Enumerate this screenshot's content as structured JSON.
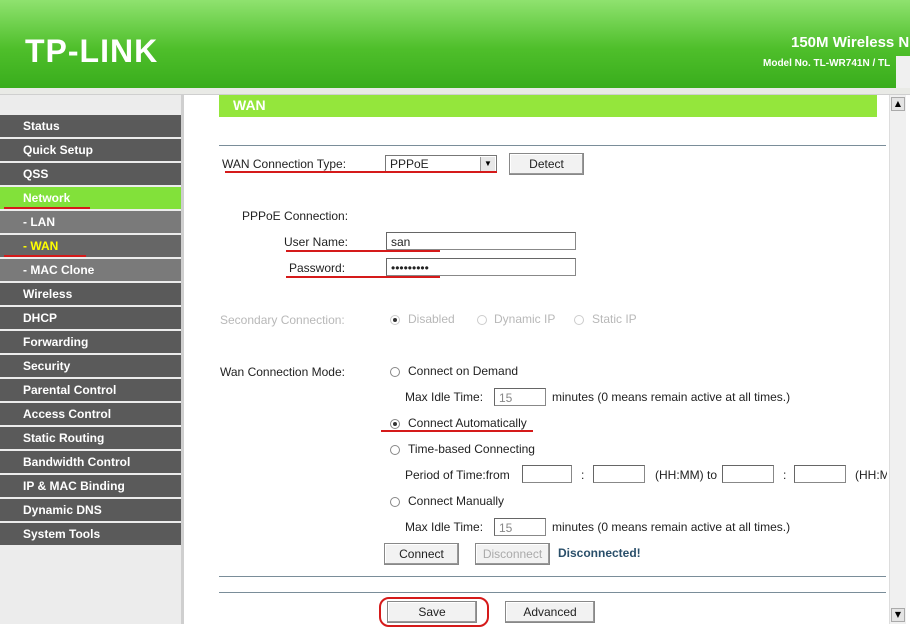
{
  "header": {
    "logo": "TP-LINK",
    "product": "150M Wireless N",
    "model": "Model No. TL-WR741N / TL"
  },
  "sidebar": {
    "items": [
      {
        "label": "Status"
      },
      {
        "label": "Quick Setup"
      },
      {
        "label": "QSS"
      },
      {
        "label": "Network"
      },
      {
        "label": "- LAN"
      },
      {
        "label": "- WAN"
      },
      {
        "label": "- MAC Clone"
      },
      {
        "label": "Wireless"
      },
      {
        "label": "DHCP"
      },
      {
        "label": "Forwarding"
      },
      {
        "label": "Security"
      },
      {
        "label": "Parental Control"
      },
      {
        "label": "Access Control"
      },
      {
        "label": "Static Routing"
      },
      {
        "label": "Bandwidth Control"
      },
      {
        "label": "IP & MAC Binding"
      },
      {
        "label": "Dynamic DNS"
      },
      {
        "label": "System Tools"
      }
    ]
  },
  "main": {
    "section_title": "WAN",
    "wan_type": {
      "label": "WAN Connection Type:",
      "value": "PPPoE",
      "detect": "Detect"
    },
    "pppoe": {
      "heading": "PPPoE Connection:",
      "username_label": "User Name:",
      "username_value": "san",
      "password_label": "Password:",
      "password_value": "•••••••••"
    },
    "secondary": {
      "label": "Secondary Connection:",
      "options": [
        "Disabled",
        "Dynamic IP",
        "Static IP"
      ]
    },
    "mode": {
      "label": "Wan Connection Mode:",
      "on_demand": "Connect on Demand",
      "max_idle_label": "Max Idle Time:",
      "max_idle_value": "15",
      "max_idle_note": "minutes (0 means remain active at all times.)",
      "auto": "Connect Automatically",
      "time_based": "Time-based Connecting",
      "period_label": "Period of Time:from",
      "hhmm_to": "(HH:MM) to",
      "colon": ":",
      "hhmm_end": "(HH:M",
      "manual": "Connect Manually",
      "max_idle_label2": "Max Idle Time:",
      "max_idle_value2": "15",
      "max_idle_note2": "minutes (0 means remain active at all times.)",
      "connect": "Connect",
      "disconnect": "Disconnect",
      "status": "Disconnected!"
    },
    "save": "Save",
    "advanced": "Advanced"
  },
  "colors": {
    "accent_green": "#94e63c",
    "menu_bg": "#5a5a5a",
    "annotation_red": "#d51a1a"
  }
}
